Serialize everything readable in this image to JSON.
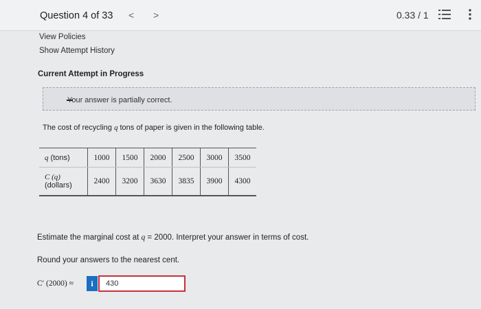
{
  "header": {
    "question_label": "Question 4 of 33",
    "prev": "<",
    "next": ">",
    "score": "0.33 / 1"
  },
  "links": {
    "view_policies": "View Policies",
    "show_history": "Show Attempt History"
  },
  "attempt_status": "Current Attempt in Progress",
  "feedback": "Your answer is partially correct.",
  "problem": {
    "intro_pre": "The cost of recycling ",
    "intro_var": "q",
    "intro_post": " tons of paper is given in the following table.",
    "table": {
      "row1_header_var": "q",
      "row1_header_unit": " (tons)",
      "row2_header_var": "C (q)",
      "row2_header_unit": "(dollars)",
      "q_values": [
        "1000",
        "1500",
        "2000",
        "2500",
        "3000",
        "3500"
      ],
      "c_values": [
        "2400",
        "3200",
        "3630",
        "3835",
        "3900",
        "4300"
      ]
    },
    "estimate_pre": "Estimate the marginal cost at ",
    "estimate_var": "q",
    "estimate_eq": " = ",
    "estimate_post": "2000. Interpret your answer in terms of cost.",
    "round_text": "Round your answers to the nearest cent.",
    "answer_label": "C′ (2000) ≈",
    "info_label": "i",
    "answer_value": "430"
  },
  "colors": {
    "accent": "#1a6fc2",
    "error_border": "#c6303a",
    "background": "#e9eaec"
  }
}
